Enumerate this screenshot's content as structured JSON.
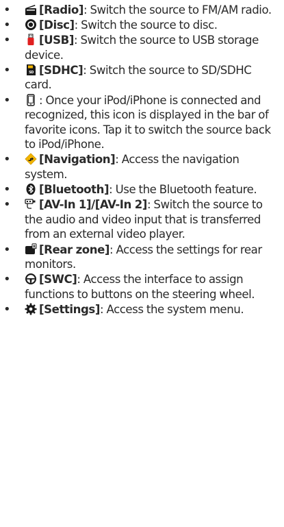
{
  "items": [
    {
      "icon": "radio-icon",
      "label": "[Radio]",
      "text": "Switch the source to FM/AM radio."
    },
    {
      "icon": "disc-icon",
      "label": "[Disc]",
      "text": "Switch the source to disc."
    },
    {
      "icon": "usb-icon",
      "label": "[USB]",
      "text": "Switch the source to USB storage device."
    },
    {
      "icon": "sd-card-icon",
      "label": "[SDHC]",
      "text": "Switch the source to SD/SDHC card."
    },
    {
      "icon": "iphone-icon",
      "label": "",
      "text": "Once your iPod/iPhone is connected and recognized, this icon is displayed in the bar of favorite icons. Tap it to switch the source back to iPod/iPhone."
    },
    {
      "icon": "navigation-icon",
      "label": "[Navigation]",
      "text": "Access the navigation system."
    },
    {
      "icon": "bluetooth-icon",
      "label": "[Bluetooth]",
      "text": "Use the Bluetooth feature."
    },
    {
      "icon": "av-in-icon",
      "label": "[AV-In 1]/[AV-In 2]",
      "text": "Switch the source to the audio and video input that is transferred from an external video player."
    },
    {
      "icon": "rear-zone-icon",
      "label": "[Rear zone]",
      "text": "Access the settings for rear monitors."
    },
    {
      "icon": "steering-wheel-icon",
      "label": "[SWC]",
      "text": "Access the interface to assign functions to buttons on the steering wheel."
    },
    {
      "icon": "settings-gear-icon",
      "label": "[Settings]",
      "text": "Access the system menu."
    }
  ],
  "colors": {
    "navigation_icon": "#f2b400",
    "usb_icon": "#e02020",
    "text": "#2a2a2a"
  }
}
